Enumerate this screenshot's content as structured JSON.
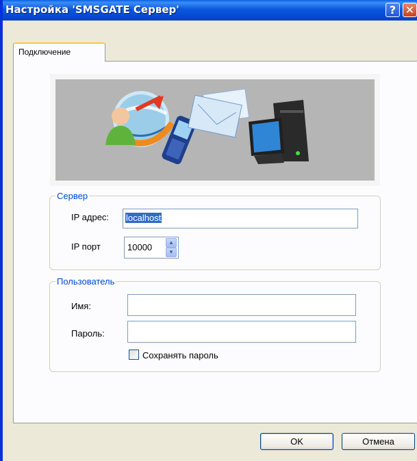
{
  "window": {
    "title": "Настройка 'SMSGATE Сервер'"
  },
  "titlebar": {
    "help_glyph": "?",
    "close_glyph": "✕"
  },
  "tabs": [
    {
      "label": "Подключение",
      "selected": true
    }
  ],
  "server": {
    "legend": "Сервер",
    "ip_label": "IP адрес:",
    "ip_value": "localhost",
    "port_label": "IP порт",
    "port_value": "10000"
  },
  "user": {
    "legend": "Пользователь",
    "name_label": "Имя:",
    "name_value": "",
    "password_label": "Пароль:",
    "password_value": "",
    "save_password_label": "Сохранять пароль",
    "save_password_checked": false
  },
  "buttons": {
    "ok": "OK",
    "cancel": "Отмена"
  },
  "colors": {
    "title_bar": "#0a58de",
    "group_legend": "#0046d5",
    "selection": "#316ac5",
    "tab_highlight": "#ffc73c"
  }
}
